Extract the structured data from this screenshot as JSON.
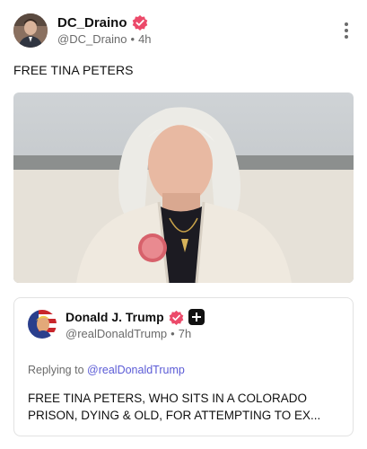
{
  "post": {
    "author": {
      "display_name": "DC_Draino",
      "handle": "@DC_Draino",
      "time": "4h",
      "verified_badge": "verified-badge-icon",
      "avatar": "avatar-photo"
    },
    "more_icon": "more-vertical-icon",
    "text": "FREE TINA PETERS",
    "image": "photo-woman-white-hair-cream-jacket"
  },
  "quoted": {
    "author": {
      "display_name": "Donald J. Trump",
      "handle": "@realDonaldTrump",
      "time": "7h",
      "verified_badge": "verified-badge-icon",
      "plus_badge": "plus-badge-icon",
      "avatar": "avatar-flag-portrait"
    },
    "replying_prefix": "Replying to",
    "replying_to": "@realDonaldTrump",
    "text": "FREE TINA PETERS, WHO SITS IN A COLORADO PRISON, DYING & OLD, FOR ATTEMPTING TO EX..."
  },
  "colors": {
    "verified": "#ec4a6a",
    "link": "#5b5bd6",
    "muted": "#6b6b6b"
  }
}
